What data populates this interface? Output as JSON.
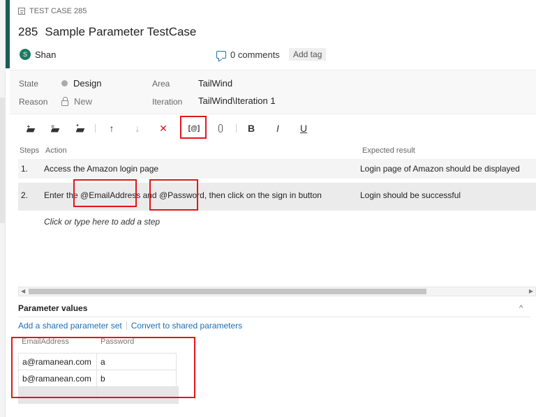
{
  "header": {
    "work_item_type": "TEST CASE 285",
    "id": "285",
    "title": "Sample Parameter TestCase",
    "assignee_initial": "S",
    "assignee_name": "Shan",
    "comments": "0 comments",
    "add_tag": "Add tag"
  },
  "fields": {
    "state_label": "State",
    "state_value": "Design",
    "reason_label": "Reason",
    "reason_value": "New",
    "area_label": "Area",
    "area_value": "TailWind",
    "iteration_label": "Iteration",
    "iteration_value": "TailWind\\Iteration 1"
  },
  "toolbar": {
    "insert_step_icon": "insert-step-icon",
    "insert_shared_steps_icon": "insert-shared-steps-icon",
    "create_shared_steps_icon": "create-shared-steps-icon",
    "move_up": "↑",
    "move_down": "↓",
    "delete": "✕",
    "insert_parameter": "[@]",
    "attachment_icon": "paperclip-icon",
    "bold": "B",
    "italic": "I",
    "underline": "U"
  },
  "steps": {
    "col_steps": "Steps",
    "col_action": "Action",
    "col_expected": "Expected result",
    "rows": [
      {
        "num": "1.",
        "action_pre": "Access the Amazon login page",
        "expected": "Login page of Amazon should be displayed"
      },
      {
        "num": "2.",
        "action_pre": "Enter the ",
        "param1": "@EmailAddress",
        "action_mid": " and ",
        "param2": "@Password",
        "action_post": ", then click on the sign in button",
        "expected": "Login should be successful"
      }
    ],
    "add_step": "Click or type here to add a step"
  },
  "parameters": {
    "title": "Parameter values",
    "add_shared": "Add a shared parameter set",
    "convert": "Convert to shared parameters",
    "headers": [
      "EmailAddress",
      "Password"
    ],
    "rows": [
      [
        "a@ramanean.com",
        "a"
      ],
      [
        "b@ramanean.com",
        "b"
      ]
    ]
  },
  "colors": {
    "accent": "#1a5c55",
    "link": "#1a6fb3",
    "highlight": "#e3141b",
    "delete": "#e3141b"
  }
}
